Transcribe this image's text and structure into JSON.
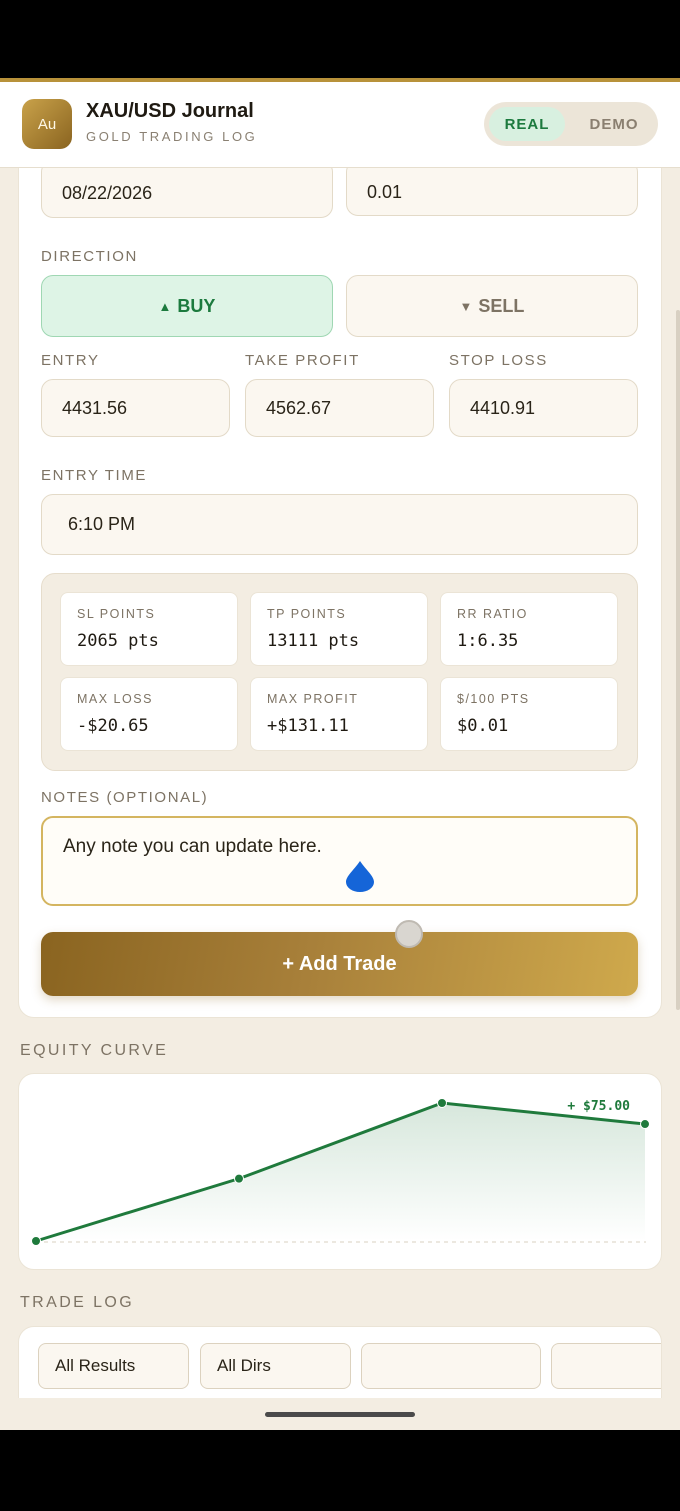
{
  "header": {
    "logo_text": "Au",
    "title": "XAU/USD Journal",
    "subtitle": "GOLD TRADING LOG",
    "mode_real": "REAL",
    "mode_demo": "DEMO",
    "active_mode": "REAL"
  },
  "form": {
    "date_value": "08/22/2026",
    "lot_value": "0.01",
    "direction_label": "DIRECTION",
    "buy_label": "BUY",
    "sell_label": "SELL",
    "selected_direction": "BUY",
    "entry_label": "ENTRY",
    "take_profit_label": "TAKE PROFIT",
    "stop_loss_label": "STOP LOSS",
    "entry_value": "4431.56",
    "take_profit_value": "4562.67",
    "stop_loss_value": "4410.91",
    "entry_time_label": "ENTRY TIME",
    "entry_time_value": "6:10 PM",
    "stats": [
      {
        "label": "SL POINTS",
        "value": "2065 pts"
      },
      {
        "label": "TP POINTS",
        "value": "13111 pts"
      },
      {
        "label": "RR RATIO",
        "value": "1:6.35"
      },
      {
        "label": "MAX LOSS",
        "value": "-$20.65"
      },
      {
        "label": "MAX PROFIT",
        "value": "+$131.11"
      },
      {
        "label": "$/100 PTS",
        "value": "$0.01"
      }
    ],
    "notes_label": "NOTES (OPTIONAL)",
    "notes_value": "Any note you can update here.",
    "add_button": "+ Add Trade"
  },
  "equity": {
    "section_title": "EQUITY CURVE",
    "last_value_label": "+ $75.00"
  },
  "chart_data": {
    "type": "line",
    "x": [
      1,
      2,
      3,
      4
    ],
    "series": [
      {
        "values": [
          0,
          40,
          88.5,
          75
        ]
      }
    ],
    "annotation": "+ $75.00",
    "grid": false
  },
  "trade_log": {
    "section_title": "TRADE LOG",
    "filters": [
      "All Results",
      "All Dirs",
      "",
      ""
    ]
  },
  "colors": {
    "accent_gold": "#b8923a",
    "buy_green": "#1c7a3e",
    "chart_line": "#1f7a3c"
  },
  "icons": {
    "buy": "triangle-up-icon",
    "sell": "triangle-down-icon"
  }
}
